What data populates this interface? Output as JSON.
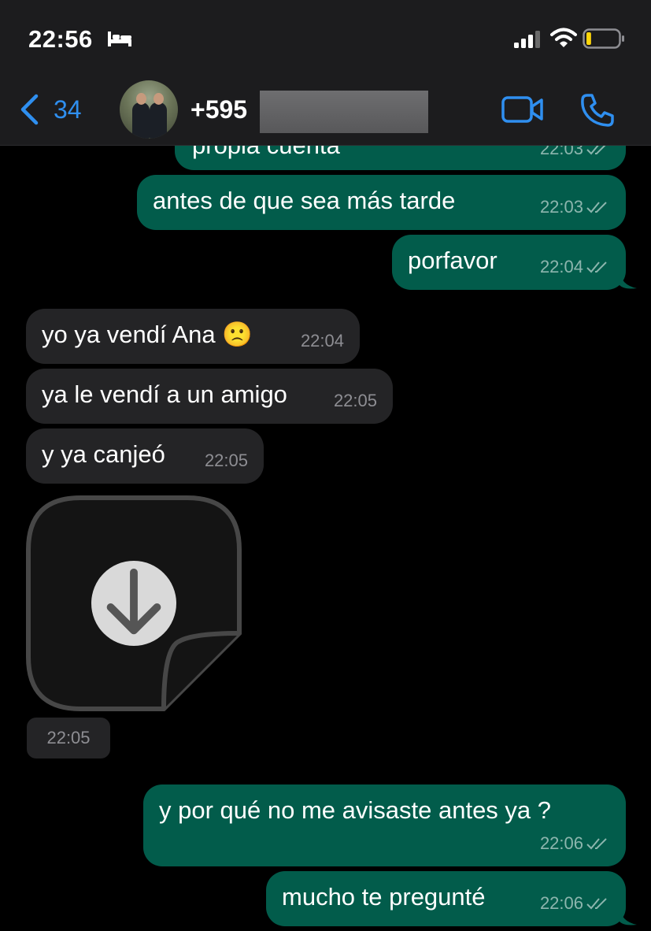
{
  "status_bar": {
    "time": "22:56",
    "icons": [
      "bed-icon",
      "signal-icon",
      "wifi-icon",
      "battery-icon"
    ],
    "battery_level": 0.15
  },
  "nav": {
    "back_count": "34",
    "contact_name": "+595",
    "actions": [
      "video-call-icon",
      "phone-call-icon"
    ]
  },
  "colors": {
    "header_bg": "#1c1c1e",
    "accent": "#2f8ff0",
    "outgoing_bubble": "#025c4b",
    "incoming_bubble": "#242426",
    "background": "#000000",
    "battery_low": "#ffd60a"
  },
  "messages": [
    {
      "dir": "out",
      "text": "propia cuenta",
      "time": "22:03",
      "read": true
    },
    {
      "dir": "out",
      "text": "antes de que sea más tarde",
      "time": "22:03",
      "read": true
    },
    {
      "dir": "out",
      "text": "porfavor",
      "time": "22:04",
      "read": true
    },
    {
      "dir": "in",
      "text": "yo ya vendí Ana 🙁",
      "time": "22:04"
    },
    {
      "dir": "in",
      "text": "ya le vendí a un amigo",
      "time": "22:05"
    },
    {
      "dir": "in",
      "text": "y ya canjeó",
      "time": "22:05"
    },
    {
      "dir": "in",
      "type": "sticker",
      "time": "22:05",
      "icon": "download-icon"
    },
    {
      "dir": "out",
      "text": "y por qué no me avisaste antes ya ?",
      "time": "22:06",
      "read": true
    },
    {
      "dir": "out",
      "text": "mucho te pregunté",
      "time": "22:06",
      "read": true
    }
  ]
}
